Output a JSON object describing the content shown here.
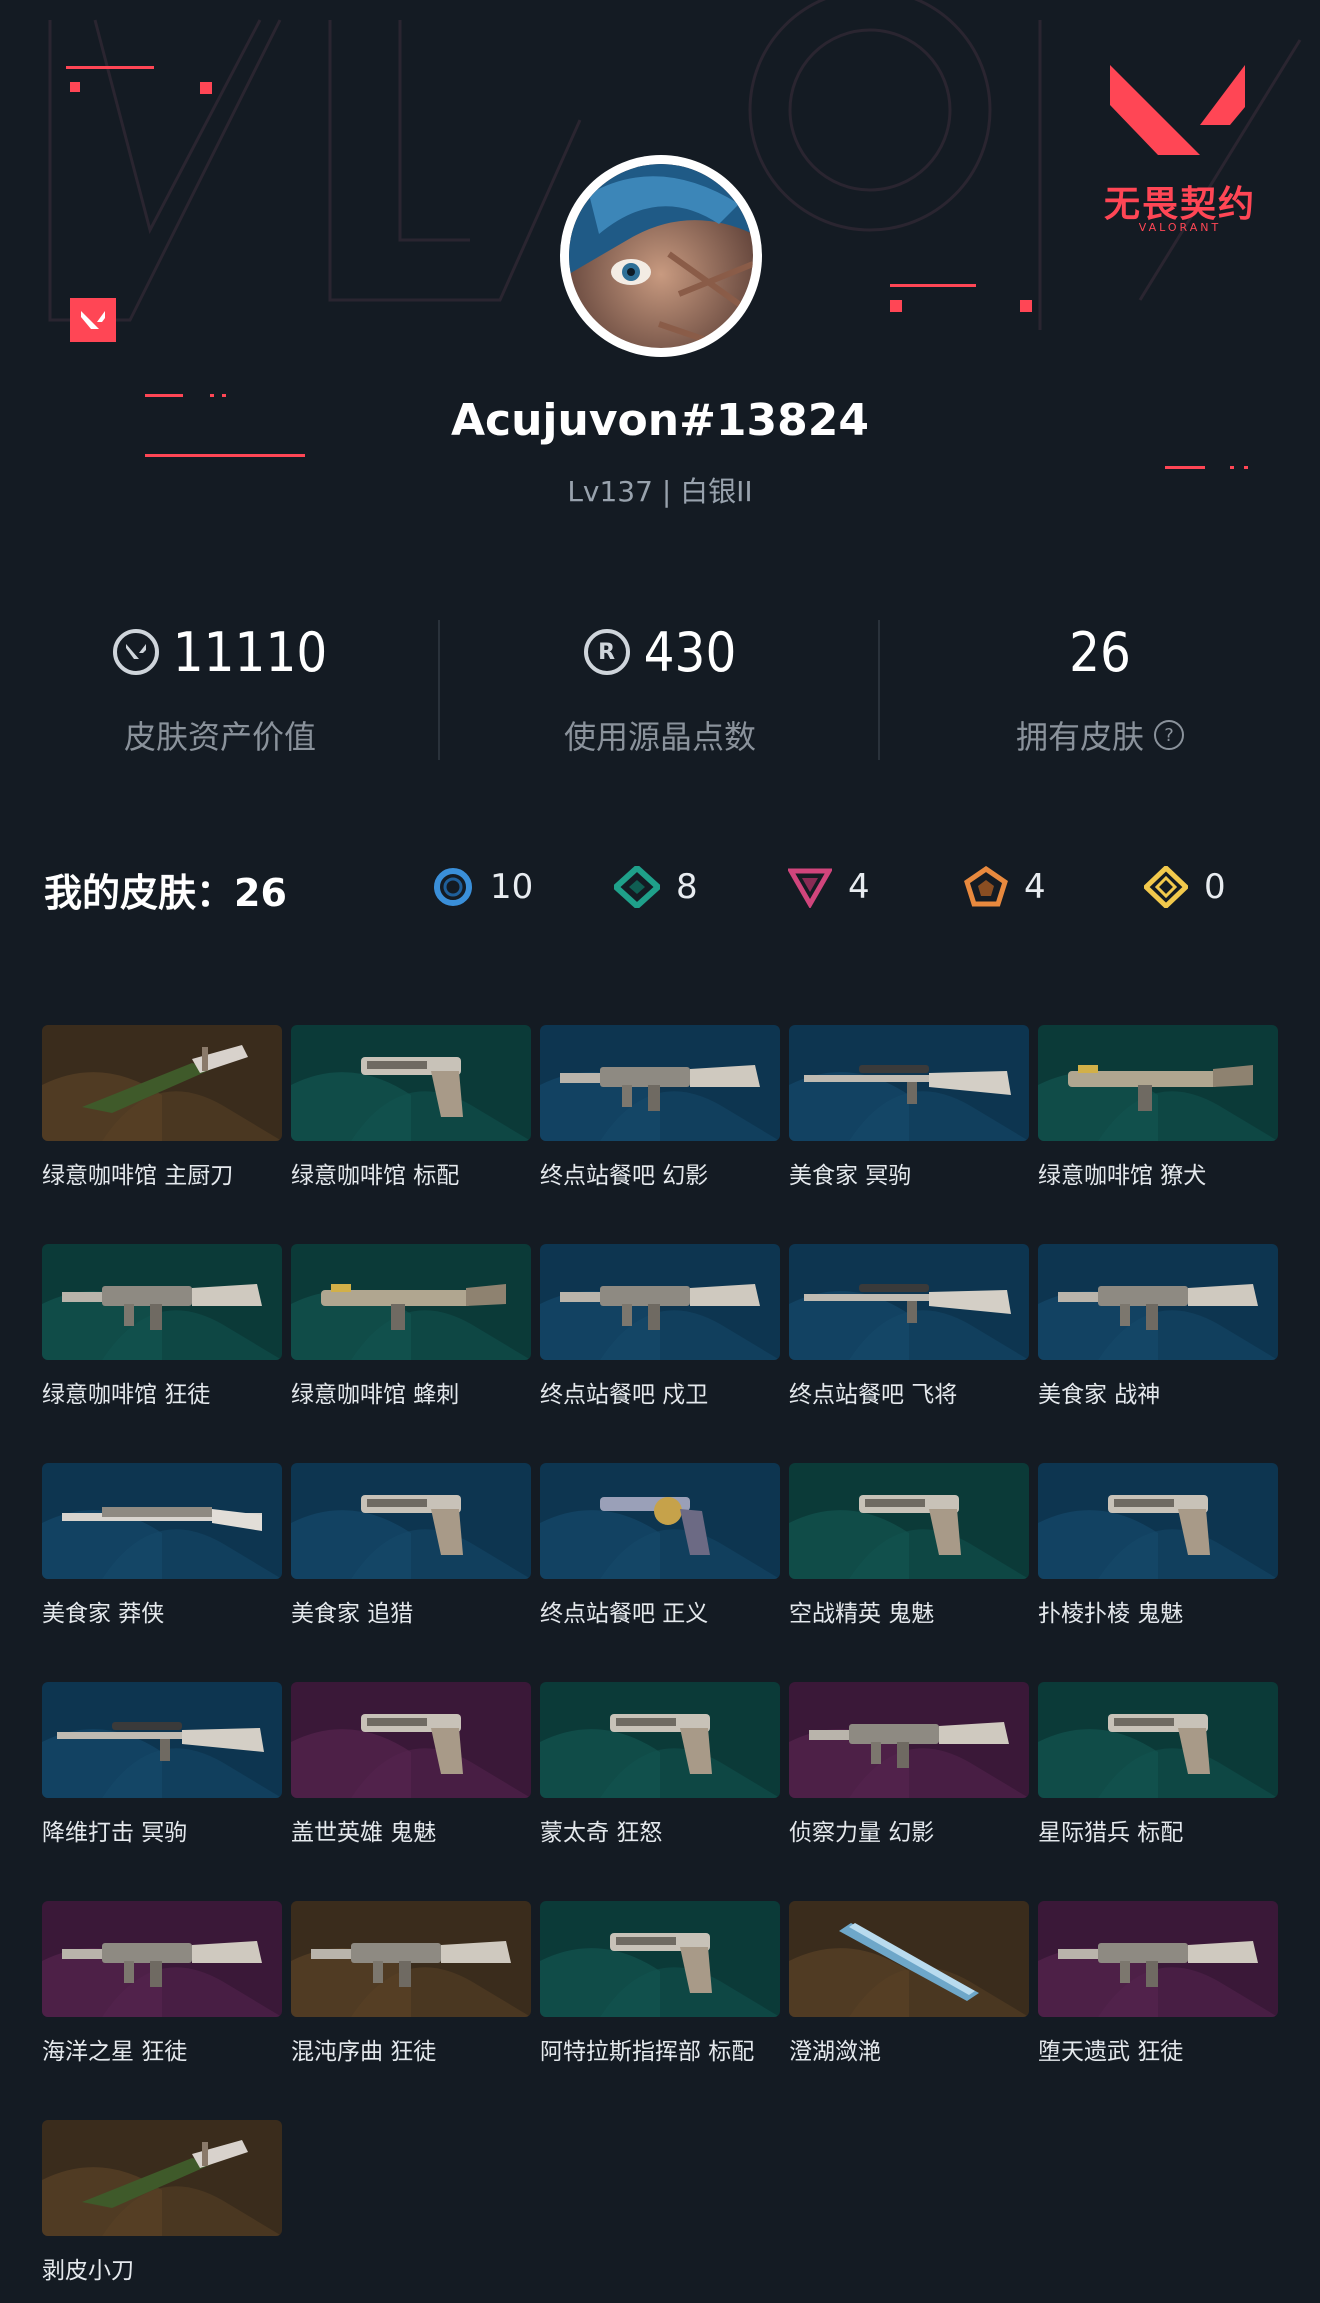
{
  "brand": {
    "logo_text": "无畏契约",
    "logo_sub": "VALORANT",
    "accent": "#ff4655"
  },
  "profile": {
    "username": "Acujuvon#13824",
    "level_text": "Lv137 | 白银II"
  },
  "stats": [
    {
      "icon": "valorant-points-icon",
      "value": "11110",
      "label": "皮肤资产价值"
    },
    {
      "icon": "radianite-icon",
      "value": "430",
      "label": "使用源晶点数"
    },
    {
      "icon": "",
      "value": "26",
      "label": "拥有皮肤"
    }
  ],
  "skins_header": {
    "label": "我的皮肤：",
    "count": "26"
  },
  "tiers": [
    {
      "icon": "select-tier-icon",
      "color": "#3a8fd9",
      "count": "10"
    },
    {
      "icon": "deluxe-tier-icon",
      "color": "#1fa08a",
      "count": "8"
    },
    {
      "icon": "premium-tier-icon",
      "color": "#d1457c",
      "count": "4"
    },
    {
      "icon": "exclusive-tier-icon",
      "color": "#e8893e",
      "count": "4"
    },
    {
      "icon": "ultra-tier-icon",
      "color": "#f2c94c",
      "count": "0"
    }
  ],
  "skins": [
    {
      "name": "绿意咖啡馆 主厨刀",
      "tier": "exclusive",
      "weapon": "knife"
    },
    {
      "name": "绿意咖啡馆 标配",
      "tier": "deluxe",
      "weapon": "pistol"
    },
    {
      "name": "终点站餐吧 幻影",
      "tier": "select",
      "weapon": "rifle"
    },
    {
      "name": "美食家 冥驹",
      "tier": "select",
      "weapon": "sniper"
    },
    {
      "name": "绿意咖啡馆 獠犬",
      "tier": "deluxe",
      "weapon": "smg"
    },
    {
      "name": "绿意咖啡馆 狂徒",
      "tier": "deluxe",
      "weapon": "rifle"
    },
    {
      "name": "绿意咖啡馆 蜂刺",
      "tier": "deluxe",
      "weapon": "smg"
    },
    {
      "name": "终点站餐吧 戍卫",
      "tier": "select",
      "weapon": "rifle"
    },
    {
      "name": "终点站餐吧 飞将",
      "tier": "select",
      "weapon": "sniper"
    },
    {
      "name": "美食家 战神",
      "tier": "select",
      "weapon": "rifle"
    },
    {
      "name": "美食家 莽侠",
      "tier": "select",
      "weapon": "shotgun"
    },
    {
      "name": "美食家 追猎",
      "tier": "select",
      "weapon": "pistol"
    },
    {
      "name": "终点站餐吧 正义",
      "tier": "select",
      "weapon": "revolver"
    },
    {
      "name": "空战精英 鬼魅",
      "tier": "deluxe",
      "weapon": "pistol"
    },
    {
      "name": "扑棱扑棱 鬼魅",
      "tier": "select",
      "weapon": "pistol"
    },
    {
      "name": "降维打击 冥驹",
      "tier": "select",
      "weapon": "sniper"
    },
    {
      "name": "盖世英雄 鬼魅",
      "tier": "premium",
      "weapon": "pistol"
    },
    {
      "name": "蒙太奇 狂怒",
      "tier": "deluxe",
      "weapon": "pistol"
    },
    {
      "name": "侦察力量 幻影",
      "tier": "premium",
      "weapon": "rifle"
    },
    {
      "name": "星际猎兵 标配",
      "tier": "deluxe",
      "weapon": "pistol"
    },
    {
      "name": "海洋之星 狂徒",
      "tier": "premium",
      "weapon": "rifle"
    },
    {
      "name": "混沌序曲 狂徒",
      "tier": "exclusive",
      "weapon": "rifle"
    },
    {
      "name": "阿特拉斯指挥部 标配",
      "tier": "deluxe",
      "weapon": "pistol"
    },
    {
      "name": "澄湖潋滟",
      "tier": "exclusive",
      "weapon": "blade"
    },
    {
      "name": "堕天遗武 狂徒",
      "tier": "premium",
      "weapon": "rifle"
    },
    {
      "name": "剥皮小刀",
      "tier": "exclusive",
      "weapon": "knife"
    }
  ],
  "tier_colors": {
    "select": [
      "#0d3550",
      "#15496a"
    ],
    "deluxe": [
      "#0b3a38",
      "#125450"
    ],
    "premium": [
      "#3a1838",
      "#56244f"
    ],
    "exclusive": [
      "#3a2c1c",
      "#5a4126"
    ]
  }
}
